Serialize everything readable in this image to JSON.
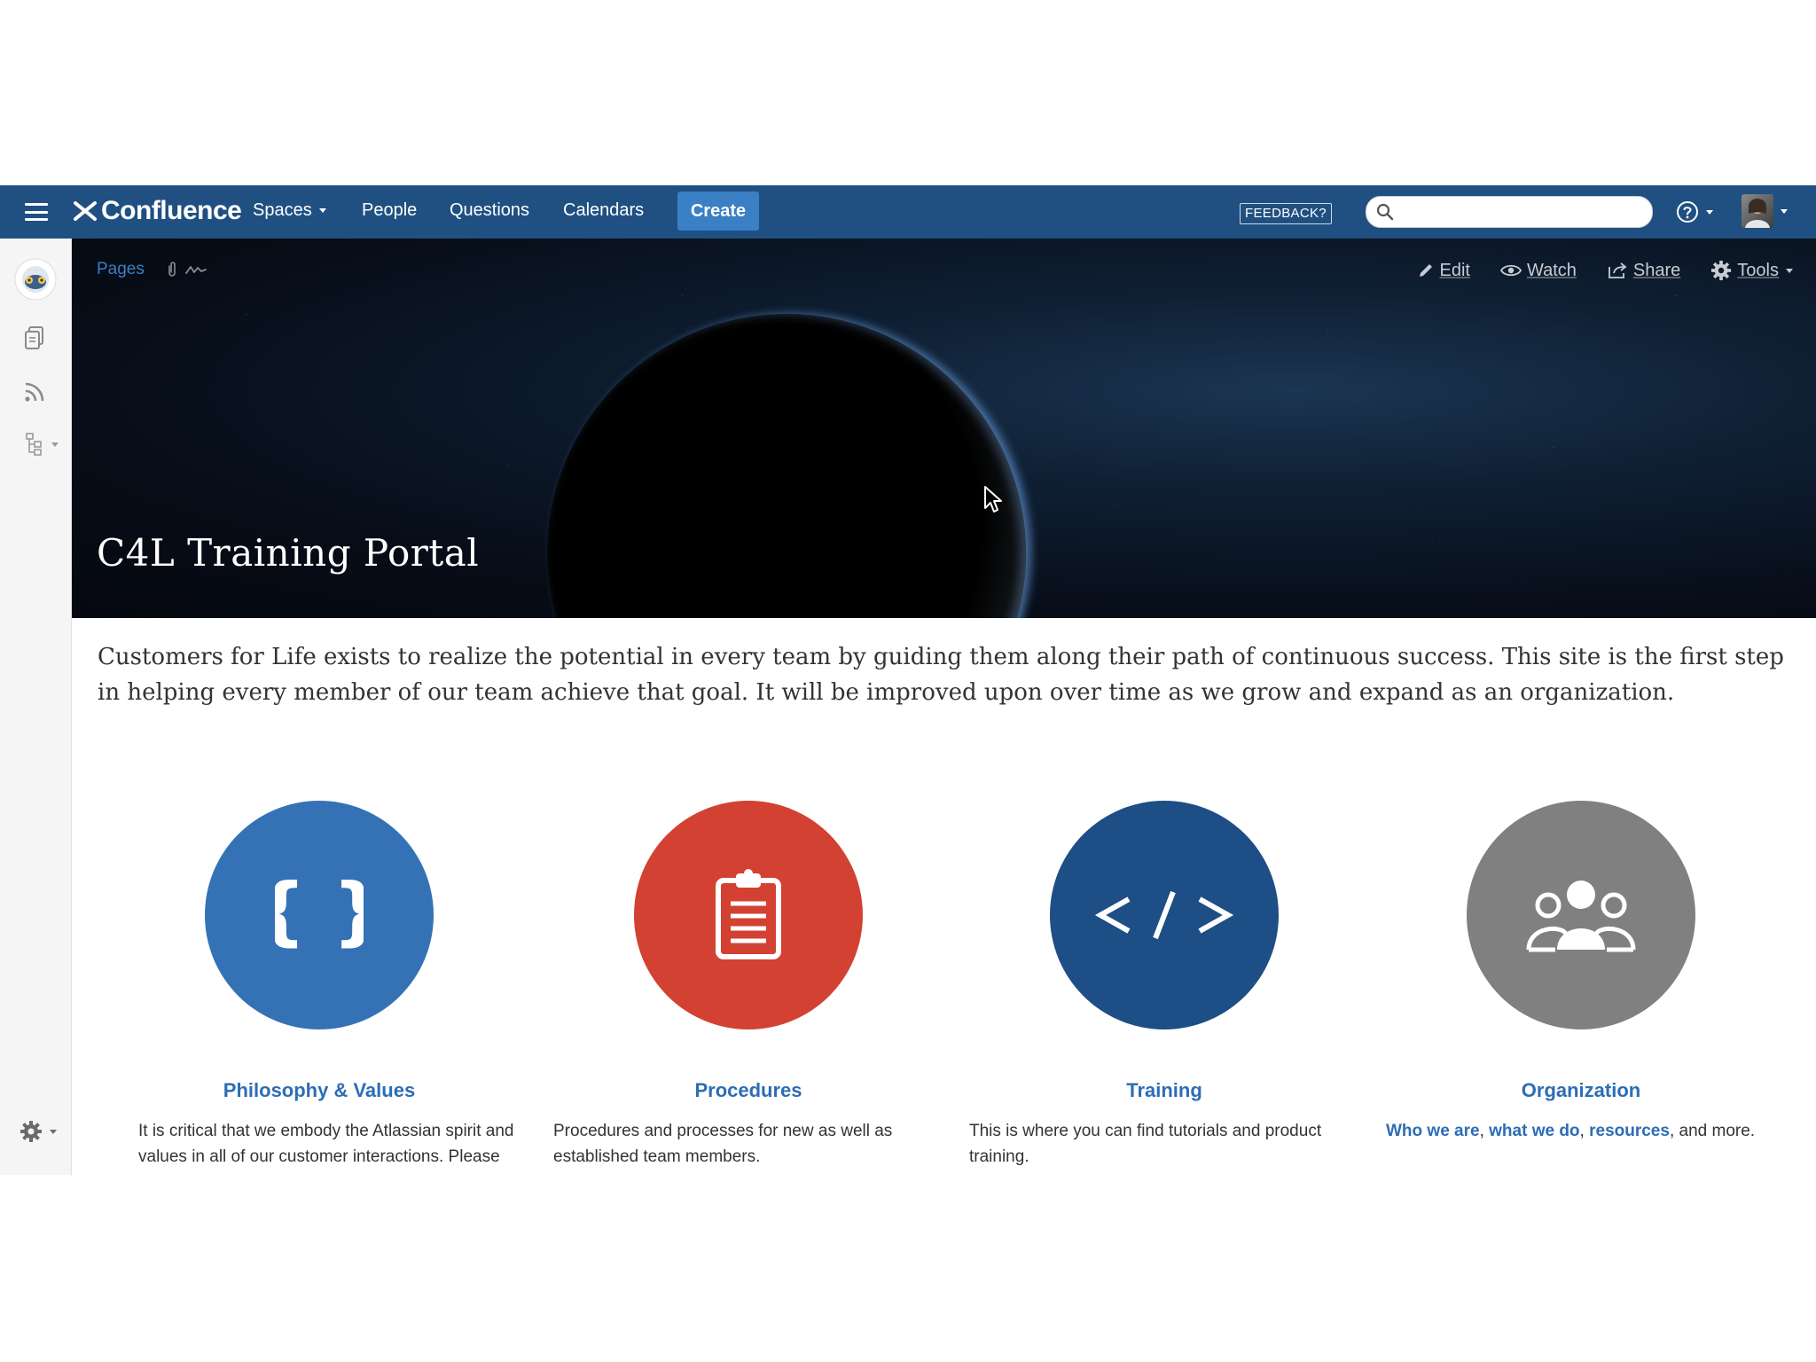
{
  "nav": {
    "logo_text": "Confluence",
    "spaces": "Spaces",
    "people": "People",
    "questions": "Questions",
    "calendars": "Calendars",
    "create": "Create",
    "feedback": "FEEDBACK?",
    "search_placeholder": ""
  },
  "page": {
    "breadcrumb_pages": "Pages",
    "actions": {
      "edit": "Edit",
      "watch": "Watch",
      "share": "Share",
      "tools": "Tools"
    },
    "title": "C4L Training Portal",
    "intro": "Customers for Life exists to realize the potential in every team by guiding them along their path of continuous success. This site is the first step in helping every member of our team achieve that goal. It will be improved upon over time as we grow and expand as an organization."
  },
  "cards": [
    {
      "title": "Philosophy & Values",
      "desc": "It is critical that we embody the Atlassian spirit and values in all of our customer interactions. Please",
      "color": "#3572b5",
      "icon": "braces-icon"
    },
    {
      "title": "Procedures",
      "desc": "Procedures and processes for new as well as established team members.",
      "color": "#d24132",
      "icon": "clipboard-icon"
    },
    {
      "title": "Training",
      "desc": "This is where you can find tutorials and product training.",
      "color": "#1d4e85",
      "icon": "code-icon"
    },
    {
      "title": "Organization",
      "desc_links": [
        "Who we are",
        "what we do",
        "resources"
      ],
      "desc_sep": ", ",
      "desc_tail": ", and more.",
      "color": "#808080",
      "icon": "people-icon"
    }
  ]
}
